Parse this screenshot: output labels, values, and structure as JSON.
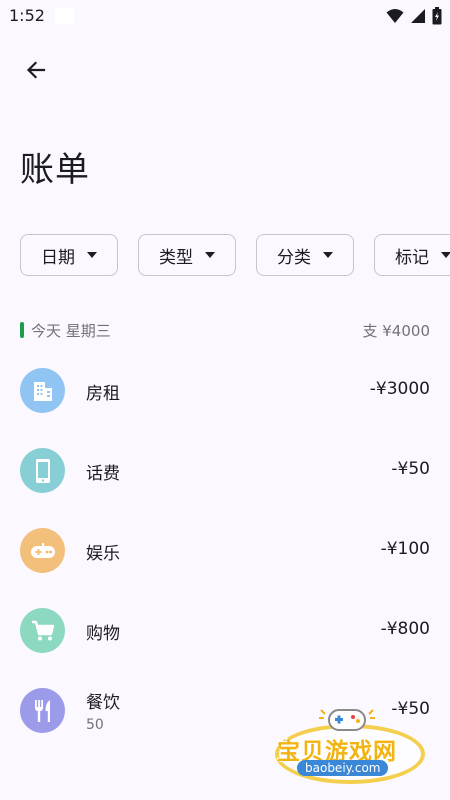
{
  "status_bar": {
    "time": "1:52"
  },
  "header": {
    "title": "账单"
  },
  "filters": [
    {
      "label": "日期"
    },
    {
      "label": "类型"
    },
    {
      "label": "分类"
    },
    {
      "label": "标记"
    }
  ],
  "day_group": {
    "label": "今天 星期三",
    "total": "支 ¥4000",
    "accent_color": "#1e9e4a"
  },
  "transactions": [
    {
      "name": "房租",
      "amount": "-¥3000",
      "icon": "building-icon",
      "color": "#90c4f2"
    },
    {
      "name": "话费",
      "amount": "-¥50",
      "icon": "phone-icon",
      "color": "#88cfd5"
    },
    {
      "name": "娱乐",
      "amount": "-¥100",
      "icon": "gamepad-icon",
      "color": "#f2c07a"
    },
    {
      "name": "购物",
      "amount": "-¥800",
      "icon": "cart-icon",
      "color": "#8cd8c0"
    },
    {
      "name": "餐饮",
      "amount": "-¥50",
      "note": "50",
      "icon": "cutlery-icon",
      "color": "#9b9bea"
    }
  ],
  "watermark": {
    "title": "宝贝游戏网",
    "subtitle": "baobeiy.com"
  }
}
